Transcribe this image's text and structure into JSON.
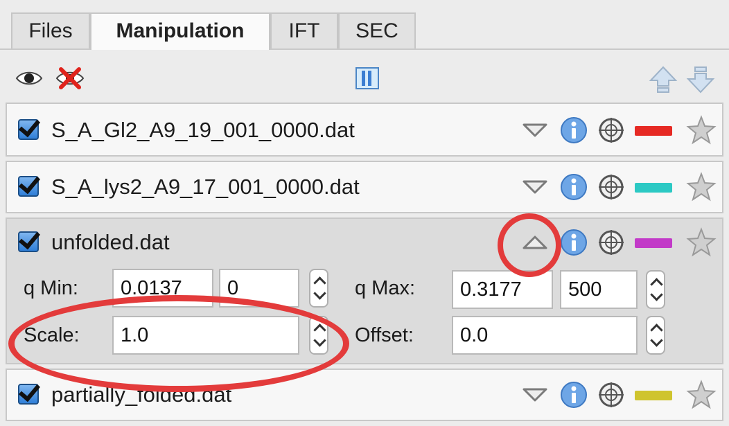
{
  "tabs": [
    {
      "label": "Files"
    },
    {
      "label": "Manipulation"
    },
    {
      "label": "IFT"
    },
    {
      "label": "SEC"
    }
  ],
  "toolbar": {
    "show_all_icon": "eye-icon",
    "hide_all_icon": "eye-crossed-icon",
    "columns_icon": "columns-icon",
    "move_up_icon": "arrow-up-icon",
    "move_down_icon": "arrow-down-icon"
  },
  "items": [
    {
      "filename": "S_A_Gl2_A9_19_001_0000.dat",
      "checked": true,
      "color": "#e62a24",
      "expanded": false
    },
    {
      "filename": "S_A_lys2_A9_17_001_0000.dat",
      "checked": true,
      "color": "#2cc9c4",
      "expanded": false
    },
    {
      "filename": "unfolded.dat",
      "checked": true,
      "color": "#c23ac8",
      "expanded": true,
      "controls": {
        "qmin_label": "q Min:",
        "qmin_value": "0.0137",
        "qmin_index": "0",
        "qmax_label": "q Max:",
        "qmax_value": "0.3177",
        "qmax_index": "500",
        "scale_label": "Scale:",
        "scale_value": "1.0",
        "offset_label": "Offset:",
        "offset_value": "0.0"
      }
    },
    {
      "filename": "partially_folded.dat",
      "checked": true,
      "color": "#cfc42e",
      "expanded": false
    }
  ],
  "annotation_color": "#e33b3b"
}
